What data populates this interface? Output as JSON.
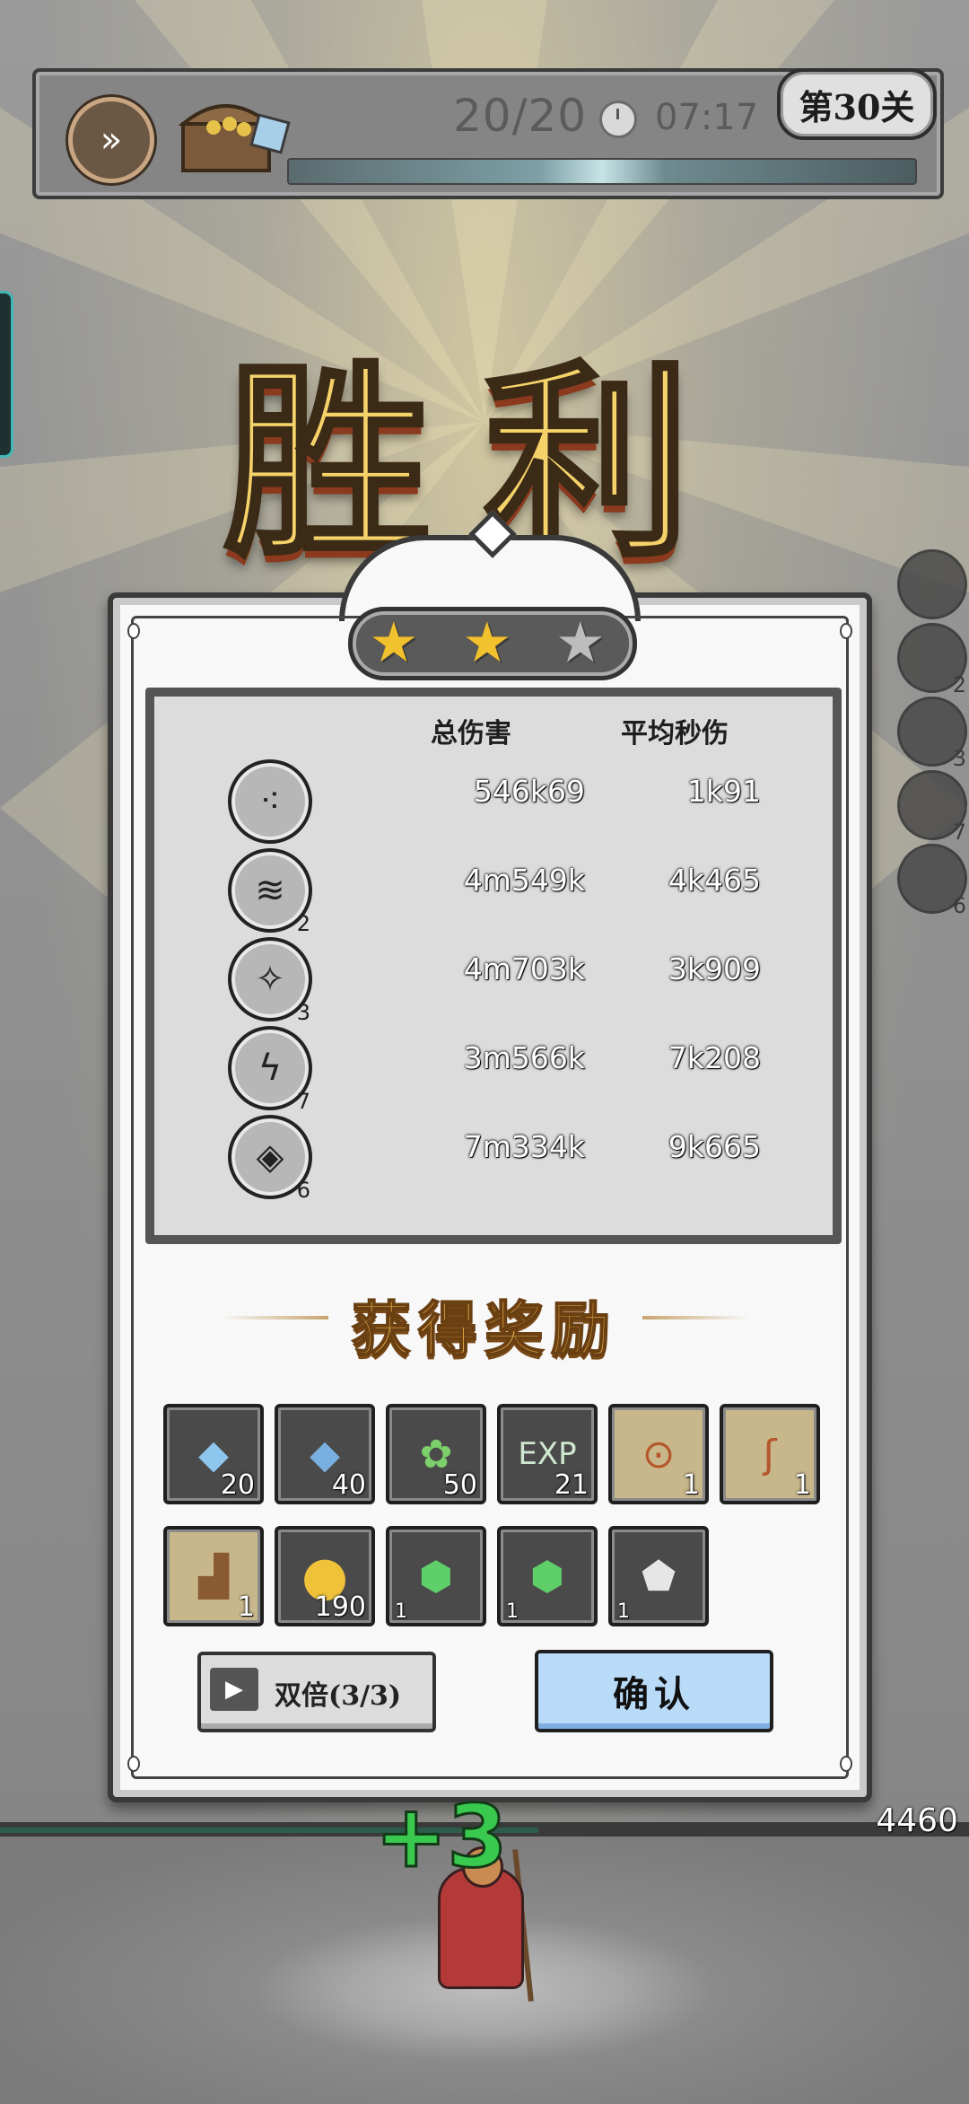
{
  "hud": {
    "wave": "20/20",
    "timer": "07:17",
    "level": "第30关"
  },
  "title": "胜利",
  "stars": {
    "earned": 2,
    "total": 3
  },
  "stats": {
    "header_total": "总伤害",
    "header_avg": "平均秒伤",
    "rows": [
      {
        "icon": "claw-slash-icon",
        "level": "",
        "total": "546k69",
        "avg": "1k91"
      },
      {
        "icon": "cracked-ground-icon",
        "level": "2",
        "total": "4m549k",
        "avg": "4k465"
      },
      {
        "icon": "crystal-cluster-icon",
        "level": "3",
        "total": "4m703k",
        "avg": "3k909"
      },
      {
        "icon": "lightning-bolt-icon",
        "level": "7",
        "total": "3m566k",
        "avg": "7k208"
      },
      {
        "icon": "ice-cube-icon",
        "level": "6",
        "total": "7m334k",
        "avg": "9k665"
      }
    ]
  },
  "rewards_title": "获得奖励",
  "rewards_row1": [
    {
      "name": "tornado-shard-icon",
      "count": "20",
      "color": "#5aa3d8"
    },
    {
      "name": "blue-shard-icon",
      "count": "40",
      "color": "#4a8ccc"
    },
    {
      "name": "green-leaf-token-icon",
      "count": "50",
      "color": "#3f7a3a"
    },
    {
      "name": "exp-orb-icon",
      "count": "21",
      "color": "#4a8a55"
    },
    {
      "name": "amulet-scroll-icon",
      "count": "1",
      "color": "#e8d6a4"
    },
    {
      "name": "staff-scroll-icon",
      "count": "1",
      "color": "#e8d6a4"
    }
  ],
  "rewards_row2": [
    {
      "name": "boot-scroll-icon",
      "count": "1",
      "color": "#e8d6a4"
    },
    {
      "name": "gold-coin-icon",
      "count": "190",
      "color": "#e0b032"
    },
    {
      "name": "green-gem-icon",
      "count": "1",
      "color": "#4fb45a"
    },
    {
      "name": "green-gem-icon",
      "count": "1",
      "color": "#4fb45a"
    },
    {
      "name": "white-ore-icon",
      "count": "1",
      "color": "#d8d8d8"
    }
  ],
  "buttons": {
    "double": "双倍(3/3)",
    "confirm": "确认"
  },
  "side_skills": [
    {
      "level": ""
    },
    {
      "level": "2"
    },
    {
      "level": "3"
    },
    {
      "level": "7"
    },
    {
      "level": "6"
    }
  ],
  "bottom": {
    "heal_popup": "+3",
    "hp": "4460"
  }
}
